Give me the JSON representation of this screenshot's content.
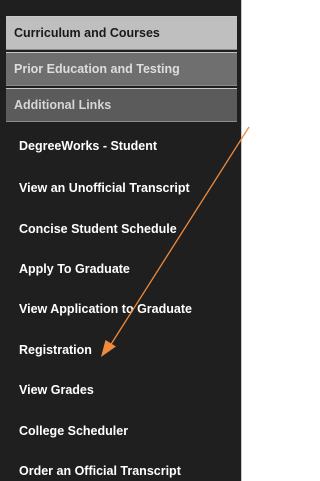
{
  "sections": [
    {
      "label": "Curriculum and Courses"
    },
    {
      "label": "Prior Education and Testing"
    },
    {
      "label": "Additional Links"
    }
  ],
  "links": [
    {
      "label": "DegreeWorks - Student"
    },
    {
      "label": "View an Unofficial Transcript"
    },
    {
      "label": "Concise Student Schedule"
    },
    {
      "label": "Apply To Graduate"
    },
    {
      "label": "View Application to Graduate"
    },
    {
      "label": "Registration"
    },
    {
      "label": "View Grades"
    },
    {
      "label": "College Scheduler"
    },
    {
      "label": "Order an Official Transcript"
    }
  ],
  "annotation": {
    "color": "#f08a3c"
  }
}
